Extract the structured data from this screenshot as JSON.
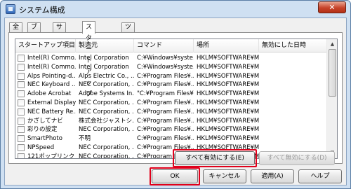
{
  "window": {
    "title": "システム構成",
    "close_label": "✕"
  },
  "tabs": [
    "全般",
    "ブート",
    "サービス",
    "スタートアップ",
    "ツール"
  ],
  "active_tab": 3,
  "columns": [
    "スタートアップ項目",
    "製造元",
    "コマンド",
    "場所",
    "無効にした日時"
  ],
  "rows": [
    {
      "item": "Intel(R) Commo...",
      "maker": "Intel Corporation",
      "command": "C:¥Windows¥syste...",
      "location": "HKLM¥SOFTWARE¥Micr...",
      "date": ""
    },
    {
      "item": "Intel(R) Commo...",
      "maker": "Intel Corporation",
      "command": "C:¥Windows¥syste...",
      "location": "HKLM¥SOFTWARE¥Micr...",
      "date": ""
    },
    {
      "item": "Alps Pointing-d...",
      "maker": "Alps Electric Co., ...",
      "command": "C:¥Program Files¥...",
      "location": "HKLM¥SOFTWARE¥Micr...",
      "date": ""
    },
    {
      "item": "NEC Keyboard ...",
      "maker": "NEC Corporation, ...",
      "command": "C:¥Program Files¥...",
      "location": "HKLM¥SOFTWARE¥Micr...",
      "date": ""
    },
    {
      "item": "Adobe Acrobat",
      "maker": "Adobe Systems In...",
      "command": "\"C:¥Program Files¥...",
      "location": "HKLM¥SOFTWARE¥Micr...",
      "date": ""
    },
    {
      "item": "External Display...",
      "maker": "NEC Corporation, ...",
      "command": "C:¥Program Files¥...",
      "location": "HKLM¥SOFTWARE¥Micr...",
      "date": ""
    },
    {
      "item": "NEC Battery Re...",
      "maker": "NEC Corporation, ...",
      "command": "C:¥Program Files¥...",
      "location": "HKLM¥SOFTWARE¥Micr...",
      "date": ""
    },
    {
      "item": "かざしてナビ",
      "maker": "株式会社ジャストシ...",
      "command": "C:¥Program Files¥...",
      "location": "HKLM¥SOFTWARE¥Micr...",
      "date": ""
    },
    {
      "item": "彩りの設定",
      "maker": "NEC Corporation, ...",
      "command": "C:¥Program Files¥...",
      "location": "HKLM¥SOFTWARE¥Micr...",
      "date": ""
    },
    {
      "item": "SmartPhoto",
      "maker": "不明",
      "command": "C:¥Program Files¥...",
      "location": "HKLM¥SOFTWARE¥Micr...",
      "date": ""
    },
    {
      "item": "NPSpeed",
      "maker": "NEC Corporation, ...",
      "command": "C:¥Program Files¥...",
      "location": "HKLM¥SOFTWARE¥Micr...",
      "date": ""
    },
    {
      "item": "121ポップリンク",
      "maker": "NEC Corporation, ...",
      "command": "C:¥Program Files¥...",
      "location": "HKLM¥SOFTWARE¥Micr...",
      "date": ""
    }
  ],
  "buttons": {
    "enable_all": "すべて有効にする(E)",
    "disable_all": "すべて無効にする(D)",
    "ok": "OK",
    "cancel": "キャンセル",
    "apply": "適用(A)",
    "help": "ヘルプ"
  },
  "scroll_arrows": {
    "up": "▲",
    "down": "▼"
  },
  "colors": {
    "highlight": "#e0001b",
    "title_bar": "#cfe0f2"
  }
}
